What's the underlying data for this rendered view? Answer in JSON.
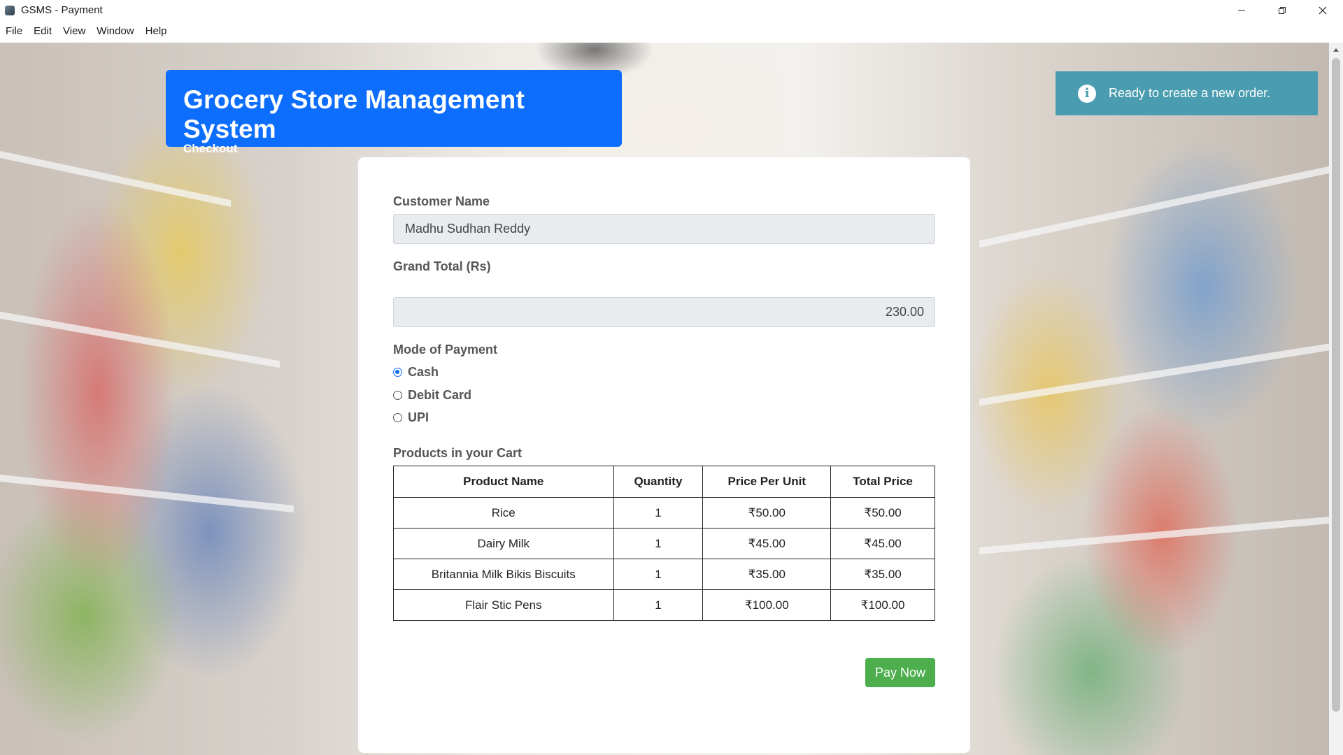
{
  "window": {
    "title": "GSMS - Payment",
    "icon": "app-icon",
    "controls": [
      "minimize-icon",
      "restore-icon",
      "close-icon"
    ]
  },
  "menu": {
    "items": [
      "File",
      "Edit",
      "View",
      "Window",
      "Help"
    ]
  },
  "header": {
    "title": "Grocery Store Management System",
    "subtitle": "Checkout",
    "color": "#0d6efd"
  },
  "toast": {
    "icon": "info-icon",
    "message": "Ready to create a new order.",
    "color": "#4a9db0"
  },
  "form": {
    "customer_name_label": "Customer Name",
    "customer_name_value": "Madhu Sudhan Reddy",
    "grand_total_label": "Grand Total (Rs)",
    "grand_total_value": "230.00",
    "payment_mode_label": "Mode of Payment",
    "payment_options": [
      {
        "label": "Cash",
        "selected": true
      },
      {
        "label": "Debit Card",
        "selected": false
      },
      {
        "label": "UPI",
        "selected": false
      }
    ]
  },
  "cart": {
    "title": "Products in your Cart",
    "columns": [
      "Product Name",
      "Quantity",
      "Price Per Unit",
      "Total Price"
    ],
    "rows": [
      [
        "Rice",
        "1",
        "₹50.00",
        "₹50.00"
      ],
      [
        "Dairy Milk",
        "1",
        "₹45.00",
        "₹45.00"
      ],
      [
        "Britannia Milk Bikis Biscuits",
        "1",
        "₹35.00",
        "₹35.00"
      ],
      [
        "Flair Stic Pens",
        "1",
        "₹100.00",
        "₹100.00"
      ]
    ]
  },
  "actions": {
    "pay_label": "Pay Now",
    "pay_color": "#4cae4c"
  }
}
